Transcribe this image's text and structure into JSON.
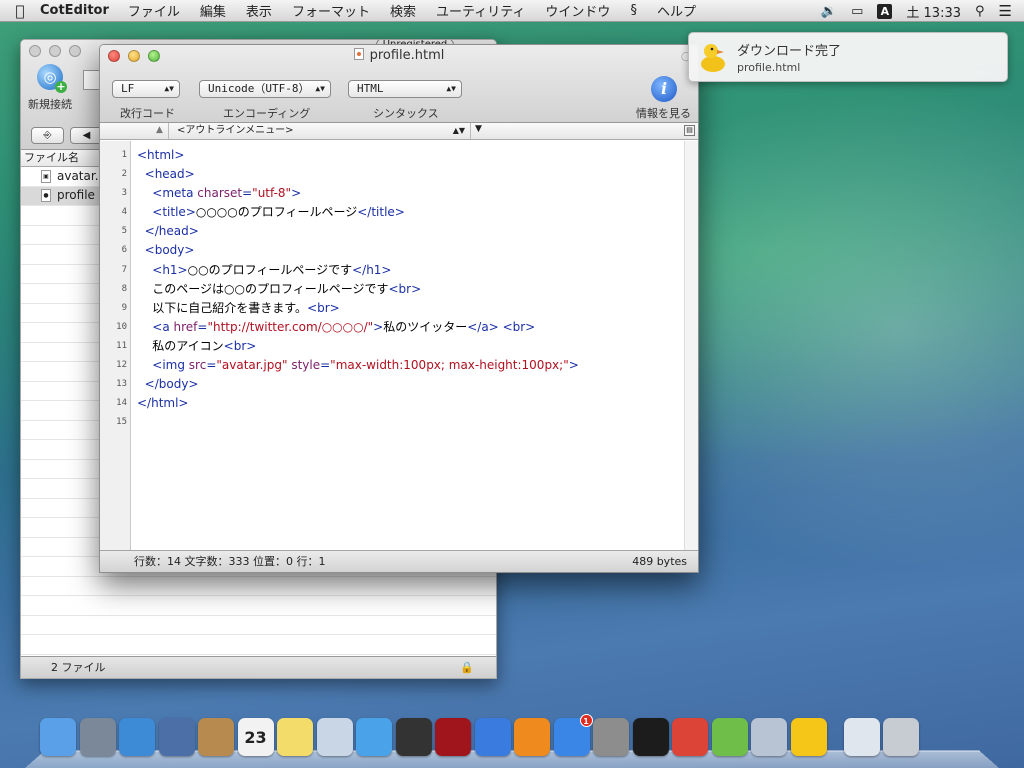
{
  "menubar": {
    "app_name": "CotEditor",
    "menus": [
      "ファイル",
      "編集",
      "表示",
      "フォーマット",
      "検索",
      "ユーティリティ",
      "ウインドウ",
      "ヘルプ"
    ],
    "input_mode": "A",
    "clock": "土 13:33"
  },
  "notification": {
    "title": "ダウンロード完了",
    "subtitle": "profile.html"
  },
  "back_window": {
    "unregistered": "Unregistered",
    "new_connection": "新規接続",
    "column_header": "ファイル名",
    "files": [
      {
        "name": "avatar.",
        "selected": false
      },
      {
        "name": "profile",
        "selected": true
      }
    ],
    "footer": "2 ファイル"
  },
  "editor_window": {
    "title": "profile.html",
    "line_ending": "LF",
    "encoding": "Unicode（UTF-8）",
    "syntax": "HTML",
    "labels": {
      "line_ending": "改行コード",
      "encoding": "エンコーディング",
      "syntax": "シンタックス",
      "info": "情報を見る"
    },
    "outline_menu": "<アウトラインメニュー>",
    "line_numbers": [
      "1",
      "2",
      "3",
      "4",
      "5",
      "6",
      "7",
      "8",
      "9",
      "10",
      "11",
      "12",
      "13",
      "14",
      "15"
    ],
    "status_left": "行数：14  文字数：333  位置：0  行：1",
    "status_right": "489 bytes"
  },
  "code_lines": [
    [
      [
        "tag",
        "<html>"
      ]
    ],
    [
      [
        "",
        "  "
      ],
      [
        "tag",
        "<head>"
      ]
    ],
    [
      [
        "",
        "    "
      ],
      [
        "tag",
        "<meta "
      ],
      [
        "att",
        "charset"
      ],
      [
        "tag",
        "="
      ],
      [
        "str",
        "\"utf-8\""
      ],
      [
        "tag",
        ">"
      ]
    ],
    [
      [
        "",
        "    "
      ],
      [
        "tag",
        "<title>"
      ],
      [
        "",
        "○○○○のプロフィールページ"
      ],
      [
        "tag",
        "</title>"
      ]
    ],
    [
      [
        "",
        "  "
      ],
      [
        "tag",
        "</head>"
      ]
    ],
    [
      [
        "",
        "  "
      ],
      [
        "tag",
        "<body>"
      ]
    ],
    [
      [
        "",
        "    "
      ],
      [
        "tag",
        "<h1>"
      ],
      [
        "",
        "○○のプロフィールページです"
      ],
      [
        "tag",
        "</h1>"
      ]
    ],
    [
      [
        "",
        "    このページは○○のプロフィールページです"
      ],
      [
        "tag",
        "<br>"
      ]
    ],
    [
      [
        "",
        "    以下に自己紹介を書きます。"
      ],
      [
        "tag",
        "<br>"
      ]
    ],
    [
      [
        "",
        "    "
      ],
      [
        "tag",
        "<a "
      ],
      [
        "att",
        "href"
      ],
      [
        "tag",
        "="
      ],
      [
        "str",
        "\"http://twitter.com/○○○○/\""
      ],
      [
        "tag",
        ">"
      ],
      [
        "",
        "私のツイッター"
      ],
      [
        "tag",
        "</a>"
      ],
      [
        "",
        " "
      ],
      [
        "tag",
        "<br>"
      ]
    ],
    [
      [
        "",
        "    私のアイコン"
      ],
      [
        "tag",
        "<br>"
      ]
    ],
    [
      [
        "",
        "    "
      ],
      [
        "tag",
        "<img "
      ],
      [
        "att",
        "src"
      ],
      [
        "tag",
        "="
      ],
      [
        "str",
        "\"avatar.jpg\""
      ],
      [
        "",
        " "
      ],
      [
        "att",
        "style"
      ],
      [
        "tag",
        "="
      ],
      [
        "str",
        "\"max-width:100px; max-height:100px;\""
      ],
      [
        "tag",
        ">"
      ]
    ],
    [
      [
        "",
        "  "
      ],
      [
        "tag",
        "</body>"
      ]
    ],
    [
      [
        "tag",
        "</html>"
      ]
    ],
    [
      [
        "",
        ""
      ]
    ]
  ],
  "dock": {
    "apps": [
      {
        "name": "finder-icon",
        "color": "#5aa0e8"
      },
      {
        "name": "launchpad-icon",
        "color": "#7a8899"
      },
      {
        "name": "safari-icon",
        "color": "#3d8ad6"
      },
      {
        "name": "mail-icon",
        "color": "#4d6fa8"
      },
      {
        "name": "contacts-icon",
        "color": "#b78a4f"
      },
      {
        "name": "calendar-icon",
        "color": "#f2f2f2",
        "text": "23"
      },
      {
        "name": "notes-icon",
        "color": "#f3dc6a"
      },
      {
        "name": "preview-icon",
        "color": "#c9d6e6"
      },
      {
        "name": "messages-icon",
        "color": "#4aa3e8"
      },
      {
        "name": "facetime-icon",
        "color": "#333333"
      },
      {
        "name": "photobooth-icon",
        "color": "#a0151b"
      },
      {
        "name": "itunes-icon",
        "color": "#3a7be0"
      },
      {
        "name": "ibooks-icon",
        "color": "#ef8a1e"
      },
      {
        "name": "app-store-icon",
        "color": "#3a86e6",
        "badge": "1"
      },
      {
        "name": "system-preferences-icon",
        "color": "#8d8d8d"
      },
      {
        "name": "terminal-icon",
        "color": "#1c1c1c"
      },
      {
        "name": "chrome-icon",
        "color": "#db4437"
      },
      {
        "name": "coteditor-icon",
        "color": "#6fbe4a"
      },
      {
        "name": "preferences-gear-icon",
        "color": "#b8c3d3"
      },
      {
        "name": "cyberduck-icon",
        "color": "#f5c518"
      }
    ],
    "right": [
      {
        "name": "downloads-stack-icon",
        "color": "#dfe6ee"
      },
      {
        "name": "trash-icon",
        "color": "#c7ccd3"
      }
    ]
  }
}
